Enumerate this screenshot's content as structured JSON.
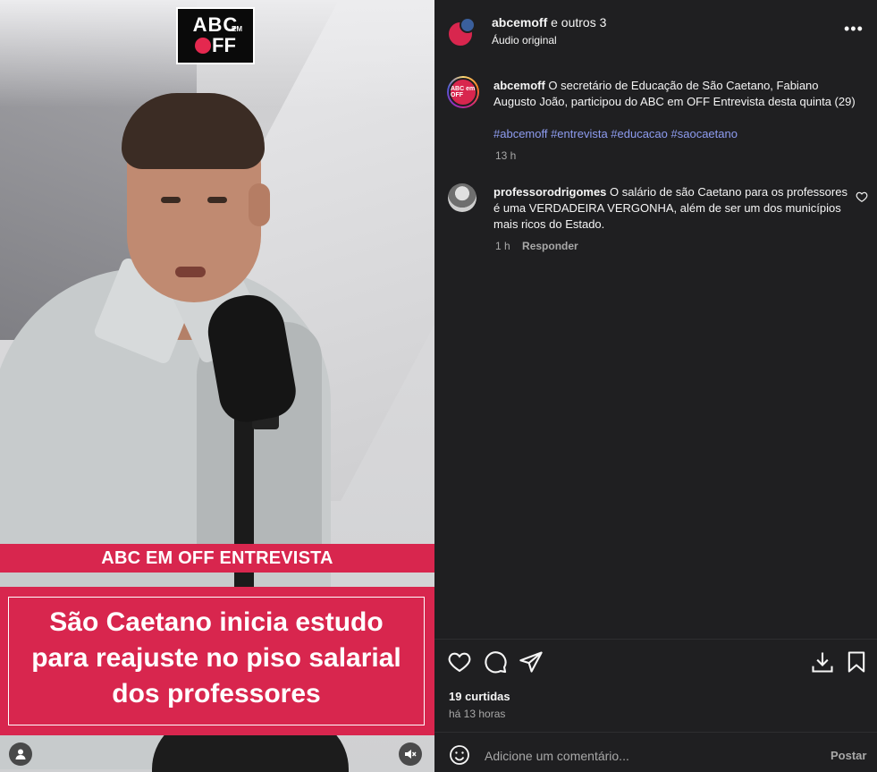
{
  "video": {
    "logo": {
      "line1": "ABC",
      "em": "EM",
      "line2": "FF"
    },
    "band_label": "ABC EM OFF ENTREVISTA",
    "headline": [
      "São Caetano inicia estudo",
      "para reajuste no piso salarial",
      "dos professores"
    ],
    "icons": {
      "account": "account-icon",
      "mute": "muted-speaker-icon"
    }
  },
  "header": {
    "username": "abcemoff",
    "others": "e outros 3",
    "audio": "Áudio original",
    "more": "•••"
  },
  "caption": {
    "avatar_text": "ABC em OFF",
    "username": "abcemoff",
    "text": "O secretário de Educação de São Caetano, Fabiano Augusto João, participou do ABC em OFF Entrevista desta quinta (29)",
    "hashtags": "#abcemoff #entrevista #educacao #saocaetano",
    "time": "13 h"
  },
  "comment": {
    "username": "professorodrigomes",
    "text": "O salário de são Caetano para os professores é uma VERDADEIRA VERGONHA, além de ser um dos municípios mais ricos do Estado.",
    "time": "1 h",
    "reply": "Responder"
  },
  "actions": {
    "icons": [
      "heart-icon",
      "comment-icon",
      "share-icon",
      "download-icon",
      "bookmark-icon"
    ]
  },
  "stats": {
    "likes": "19 curtidas",
    "ago": "há 13 horas"
  },
  "composer": {
    "placeholder": "Adicione um comentário...",
    "post_label": "Postar"
  },
  "colors": {
    "brand_pink": "#d8264e",
    "panel_bg": "#1f1f21",
    "hashtag": "#8e9cf0",
    "muted_text": "#a8a8a8"
  }
}
